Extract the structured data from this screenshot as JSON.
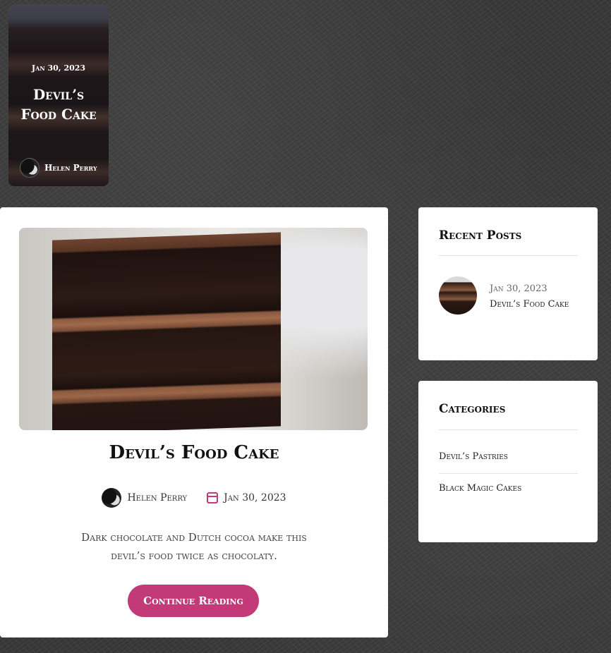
{
  "slider": {
    "date": "Jan 30, 2023",
    "title": "Devil’s Food Cake",
    "author": "Helen Perry"
  },
  "post": {
    "title": "Devil’s Food Cake",
    "author": "Helen Perry",
    "date": "Jan 30, 2023",
    "excerpt": "Dark chocolate and Dutch cocoa make this devil’s food twice as chocolaty.",
    "button_label": "Continue Reading"
  },
  "sidebar": {
    "recent_posts": {
      "title": "Recent Posts",
      "items": [
        {
          "date": "Jan 30, 2023",
          "title": "Devil’s Food Cake"
        }
      ]
    },
    "categories": {
      "title": "Categories",
      "items": [
        {
          "label": "Devil’s Pastries"
        },
        {
          "label": "Black Magic Cakes"
        }
      ]
    }
  },
  "colors": {
    "accent": "#c23a78",
    "background": "#3a3a3a",
    "card": "#ffffff"
  },
  "icons": {
    "date": "calendar-icon",
    "avatar": "author-avatar"
  }
}
